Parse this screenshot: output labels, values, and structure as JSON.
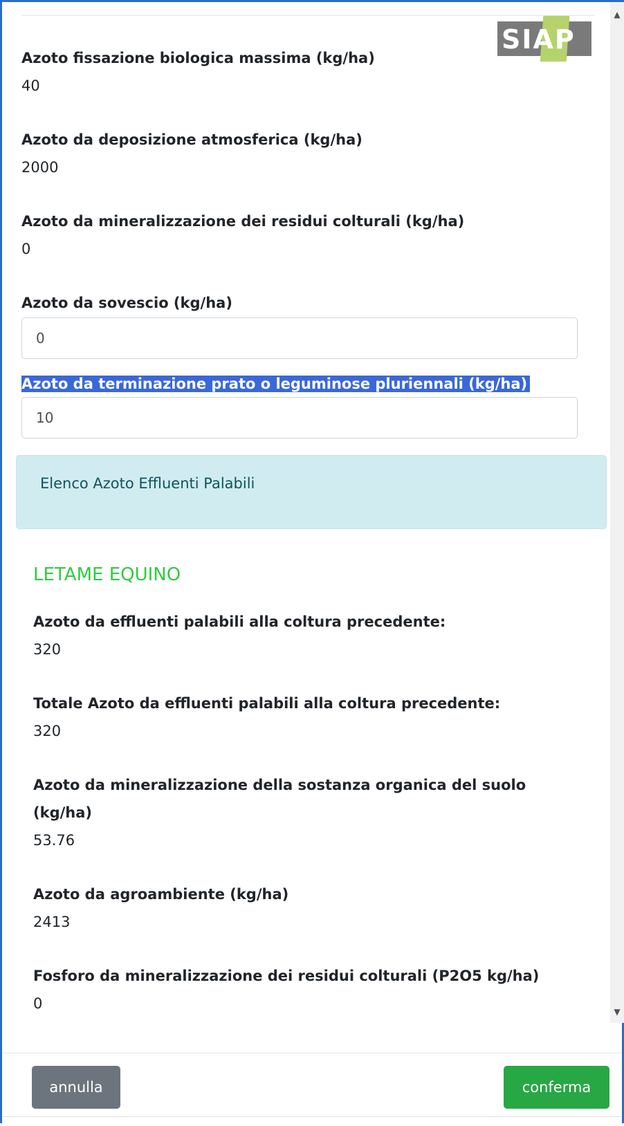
{
  "logo": {
    "text": "SIAP",
    "colors": {
      "background": "#7a7a7a",
      "accent": "#b5d36b"
    }
  },
  "fields": {
    "max_biological_fixation": {
      "label": "Azoto fissazione biologica massima (kg/ha)",
      "value": "40"
    },
    "atmospheric_deposition": {
      "label": "Azoto da deposizione atmosferica (kg/ha)",
      "value": "2000"
    },
    "crop_residue_mineralization": {
      "label": "Azoto da mineralizzazione dei residui colturali (kg/ha)",
      "value": "0"
    },
    "green_manure": {
      "label": "Azoto da sovescio (kg/ha)",
      "value": "0"
    },
    "meadow_termination": {
      "label": "Azoto da terminazione prato o leguminose pluriennali (kg/ha)",
      "value": "10"
    }
  },
  "alert": {
    "text": "Elenco Azoto Effluenti Palabili"
  },
  "effluent_section": {
    "title": "LETAME EQUINO",
    "items": {
      "previous_crop": {
        "label": "Azoto da effluenti palabili alla coltura precedente:",
        "value": "320"
      },
      "total_previous_crop": {
        "label": "Totale Azoto da effluenti palabili alla coltura precedente:",
        "value": "320"
      },
      "soil_organic_mineralization": {
        "label_line1": "Azoto da mineralizzazione della sostanza organica del suolo",
        "label_line2": "(kg/ha)",
        "value": "53.76"
      },
      "agroenvironment": {
        "label": "Azoto da agroambiente (kg/ha)",
        "value": "2413"
      },
      "phosphorus_residues": {
        "label": "Fosforo da mineralizzazione dei residui colturali (P2O5 kg/ha)",
        "value": "0"
      }
    }
  },
  "scrollbar": {
    "up_icon": "triangle-up",
    "down_icon": "triangle-down"
  },
  "footer": {
    "cancel_label": "annulla",
    "confirm_label": "conferma"
  },
  "colors": {
    "modal_border": "#2b6cc4",
    "selection": "#3b68d8",
    "alert_bg": "#d1ecf1",
    "alert_text": "#0c5460",
    "section_title": "#2ecc40",
    "cancel_button": "#6c757d",
    "confirm_button": "#28a745"
  }
}
